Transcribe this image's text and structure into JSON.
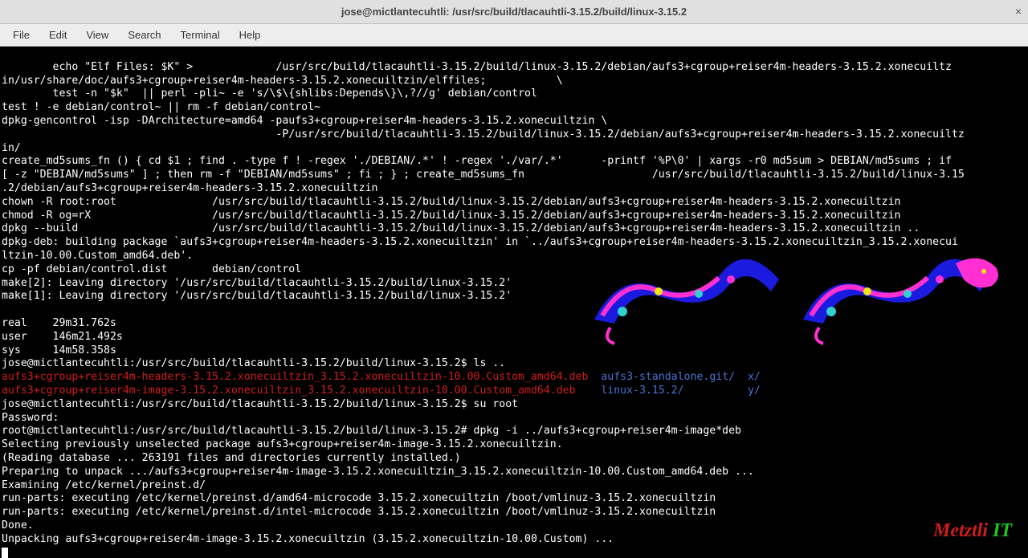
{
  "window": {
    "title": "jose@mictlantecuhtli: /usr/src/build/tlacauhtli-3.15.2/build/linux-3.15.2",
    "close_glyph": "×"
  },
  "menu": {
    "file": "File",
    "edit": "Edit",
    "view": "View",
    "search": "Search",
    "terminal": "Terminal",
    "help": "Help"
  },
  "terminal": {
    "line01": "        echo \"Elf Files: $K\" >             /usr/src/build/tlacauhtli-3.15.2/build/linux-3.15.2/debian/aufs3+cgroup+reiser4m-headers-3.15.2.xonecuiltz",
    "line02": "in/usr/share/doc/aufs3+cgroup+reiser4m-headers-3.15.2.xonecuiltzin/elffiles;           \\",
    "line03": "        test -n \"$k\"  || perl -pli~ -e 's/\\$\\{shlibs:Depends\\}\\,?//g' debian/control",
    "line04": "test ! -e debian/control~ || rm -f debian/control~",
    "line05": "dpkg-gencontrol -isp -DArchitecture=amd64 -paufs3+cgroup+reiser4m-headers-3.15.2.xonecuiltzin \\",
    "line06": "                                           -P/usr/src/build/tlacauhtli-3.15.2/build/linux-3.15.2/debian/aufs3+cgroup+reiser4m-headers-3.15.2.xonecuiltz",
    "line07": "in/",
    "line08": "create_md5sums_fn () { cd $1 ; find . -type f ! -regex './DEBIAN/.*' ! -regex './var/.*'      -printf '%P\\0' | xargs -r0 md5sum > DEBIAN/md5sums ; if",
    "line09": "[ -z \"DEBIAN/md5sums\" ] ; then rm -f \"DEBIAN/md5sums\" ; fi ; } ; create_md5sums_fn                    /usr/src/build/tlacauhtli-3.15.2/build/linux-3.15",
    "line10": ".2/debian/aufs3+cgroup+reiser4m-headers-3.15.2.xonecuiltzin",
    "line11": "chown -R root:root               /usr/src/build/tlacauhtli-3.15.2/build/linux-3.15.2/debian/aufs3+cgroup+reiser4m-headers-3.15.2.xonecuiltzin",
    "line12": "chmod -R og=rX                   /usr/src/build/tlacauhtli-3.15.2/build/linux-3.15.2/debian/aufs3+cgroup+reiser4m-headers-3.15.2.xonecuiltzin",
    "line13": "dpkg --build                     /usr/src/build/tlacauhtli-3.15.2/build/linux-3.15.2/debian/aufs3+cgroup+reiser4m-headers-3.15.2.xonecuiltzin ..",
    "line14": "dpkg-deb: building package `aufs3+cgroup+reiser4m-headers-3.15.2.xonecuiltzin' in `../aufs3+cgroup+reiser4m-headers-3.15.2.xonecuiltzin_3.15.2.xonecui",
    "line15": "ltzin-10.00.Custom_amd64.deb'.",
    "line16": "cp -pf debian/control.dist       debian/control",
    "line17": "make[2]: Leaving directory '/usr/src/build/tlacauhtli-3.15.2/build/linux-3.15.2'",
    "line18": "make[1]: Leaving directory '/usr/src/build/tlacauhtli-3.15.2/build/linux-3.15.2'",
    "line19": "",
    "line20": "real    29m31.762s",
    "line21": "user    146m21.492s",
    "line22": "sys     14m58.358s",
    "line23": "jose@mictlantecuhtli:/usr/src/build/tlacauhtli-3.15.2/build/linux-3.15.2$ ls ..",
    "ls_red1": "aufs3+cgroup+reiser4m-headers-3.15.2.xonecuiltzin_3.15.2.xonecuiltzin-10.00.Custom_amd64.deb",
    "ls_blue1": "aufs3-standalone.git/",
    "ls_blue1b": "x/",
    "ls_red2": "aufs3+cgroup+reiser4m-image-3.15.2.xonecuiltzin_3.15.2.xonecuiltzin-10.00.Custom_amd64.deb",
    "ls_blue2": "linux-3.15.2/",
    "ls_blue2b": "y/",
    "line26": "jose@mictlantecuhtli:/usr/src/build/tlacauhtli-3.15.2/build/linux-3.15.2$ su root",
    "line27": "Password:",
    "line28": "root@mictlantecuhtli:/usr/src/build/tlacauhtli-3.15.2/build/linux-3.15.2# dpkg -i ../aufs3+cgroup+reiser4m-image*deb",
    "line29": "Selecting previously unselected package aufs3+cgroup+reiser4m-image-3.15.2.xonecuiltzin.",
    "line30": "(Reading database ... 263191 files and directories currently installed.)",
    "line31": "Preparing to unpack .../aufs3+cgroup+reiser4m-image-3.15.2.xonecuiltzin_3.15.2.xonecuiltzin-10.00.Custom_amd64.deb ...",
    "line32": "Examining /etc/kernel/preinst.d/",
    "line33": "run-parts: executing /etc/kernel/preinst.d/amd64-microcode 3.15.2.xonecuiltzin /boot/vmlinuz-3.15.2.xonecuiltzin",
    "line34": "run-parts: executing /etc/kernel/preinst.d/intel-microcode 3.15.2.xonecuiltzin /boot/vmlinuz-3.15.2.xonecuiltzin",
    "line35": "Done.",
    "line36": "Unpacking aufs3+cgroup+reiser4m-image-3.15.2.xonecuiltzin (3.15.2.xonecuiltzin-10.00.Custom) ..."
  },
  "watermark": {
    "part1": "Metztli ",
    "part2": "IT"
  }
}
